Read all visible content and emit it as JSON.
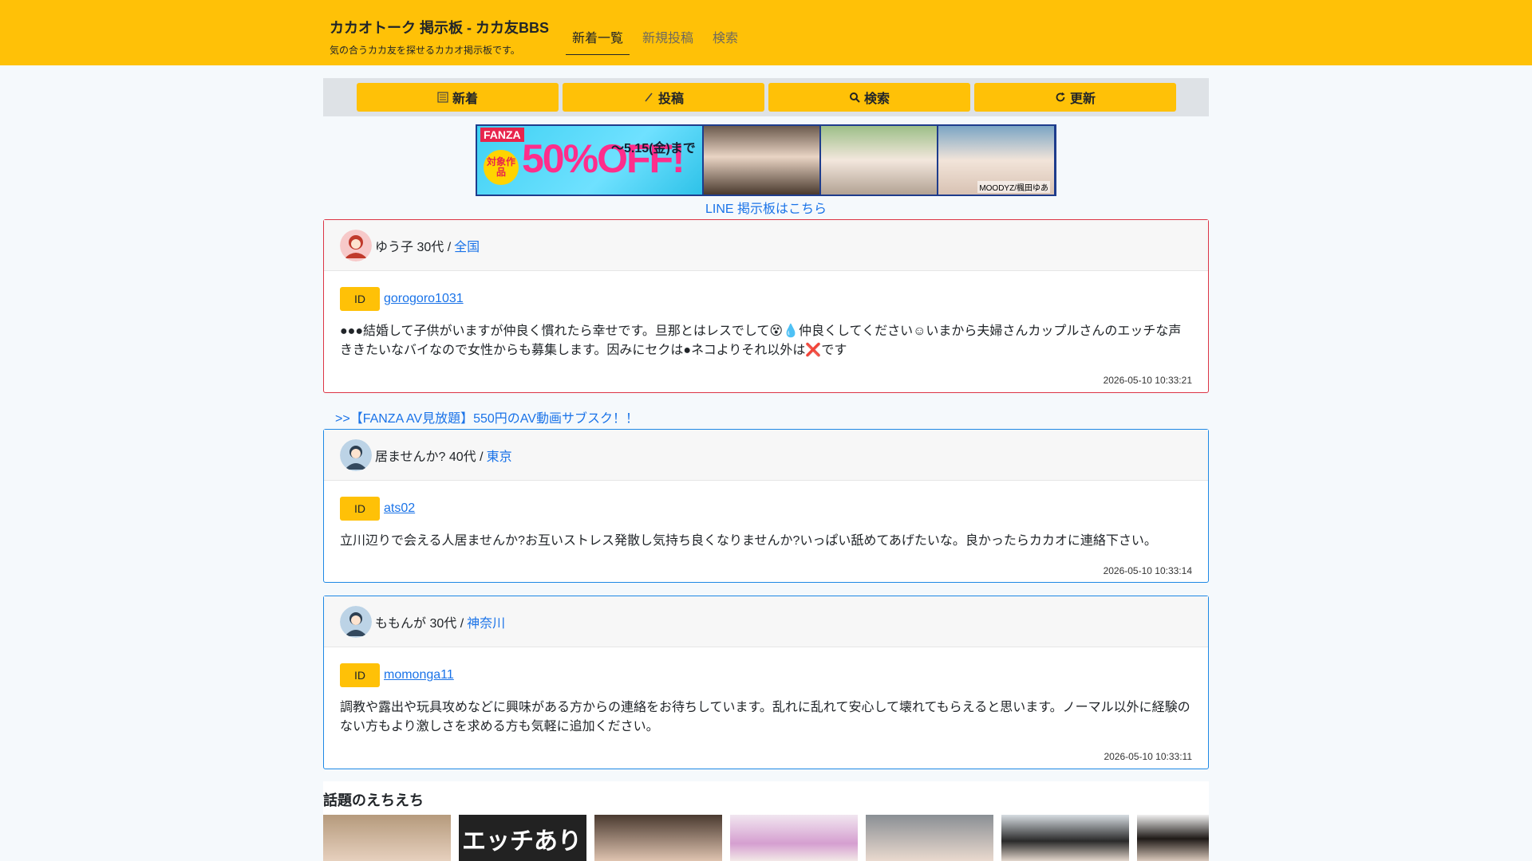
{
  "header": {
    "title": "カカオトーク 掲示板 - カカ友BBS",
    "subtitle": "気の合うカカ友を探せるカカオ掲示板です。",
    "nav": [
      "新着一覧",
      "新規投稿",
      "検索"
    ]
  },
  "toolbar": {
    "new": "新着",
    "post": "投稿",
    "search": "検索",
    "refresh": "更新"
  },
  "banner": {
    "brand": "FANZA",
    "badge": "対象作品",
    "discount": "50%OFF!",
    "until": "～5.15(金)まで",
    "credit": "MOODYZ/楓田ゆあ"
  },
  "line_link": "LINE 掲示板はこちら",
  "fanza_link": ">>【FANZA AV見放題】550円のAV動画サブスク！！",
  "posts": [
    {
      "name_age": "ゆう子 30代 /",
      "area": "全国",
      "id_label": "ID",
      "user_id": "gorogoro1031",
      "message": "●●●結婚して子供がいますが仲良く慣れたら幸せです。旦那とはレスでして😵💧仲良くしてください☺いまから夫婦さんカップルさんのエッチな声ききたいなバイなので女性からも募集します。因みにセクは●ネコよりそれ以外は❌です",
      "timestamp": "2026-05-10 10:33:21"
    },
    {
      "name_age": "居ませんか? 40代 /",
      "area": "東京",
      "id_label": "ID",
      "user_id": "ats02",
      "message": "立川辺りで会える人居ませんか?お互いストレス発散し気持ち良くなりませんか?いっぱい舐めてあげたいな。良かったらカカオに連絡下さい。",
      "timestamp": "2026-05-10 10:33:14"
    },
    {
      "name_age": "ももんが 30代 /",
      "area": "神奈川",
      "id_label": "ID",
      "user_id": "momonga11",
      "message": "調教や露出や玩具攻めなどに興味がある方からの連絡をお待ちしています。乱れに乱れて安心して壊れてもらえると思います。ノーマル以外に経験のない方もより激しさを求める方も気軽に追加ください。",
      "timestamp": "2026-05-10 10:33:11"
    }
  ],
  "trending": {
    "title": "話題のえちえち",
    "thumb_text": "エッチあり"
  }
}
